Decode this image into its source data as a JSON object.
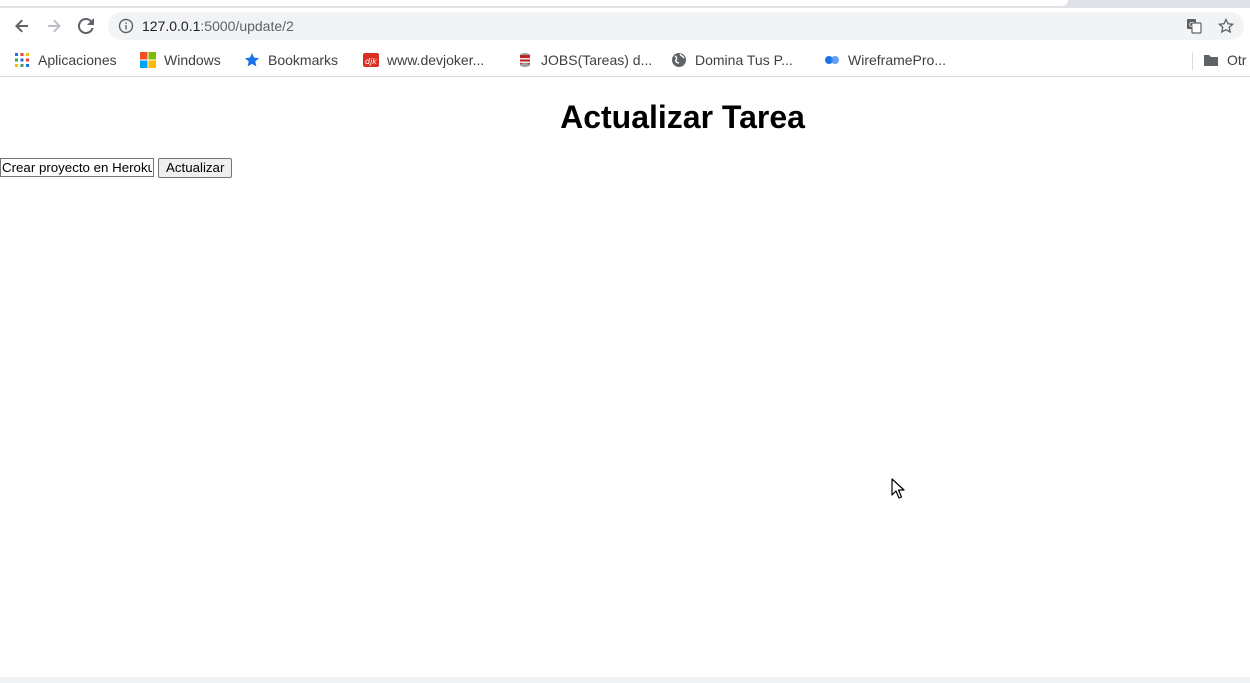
{
  "browser": {
    "url_host": "127.0.0.1",
    "url_path": ":5000/update/2",
    "bookmarks": [
      {
        "label": "Aplicaciones",
        "icon": "apps-grid-icon"
      },
      {
        "label": "Windows",
        "icon": "windows-logo-icon"
      },
      {
        "label": "Bookmarks",
        "icon": "star-icon"
      },
      {
        "label": "www.devjoker...",
        "icon": "devjoker-icon"
      },
      {
        "label": "JOBS(Tareas) d...",
        "icon": "database-icon"
      },
      {
        "label": "Domina Tus P...",
        "icon": "globe-icon"
      },
      {
        "label": "WireframePro...",
        "icon": "wireframepro-icon"
      },
      {
        "label": "Otr",
        "icon": "folder-icon"
      }
    ]
  },
  "page": {
    "title": "Actualizar Tarea",
    "task_input_value": "Crear proyecto en Heroku",
    "submit_label": "Actualizar"
  },
  "colors": {
    "accent_blue": "#1a73e8",
    "toolbar_bg": "#f1f3f4"
  }
}
